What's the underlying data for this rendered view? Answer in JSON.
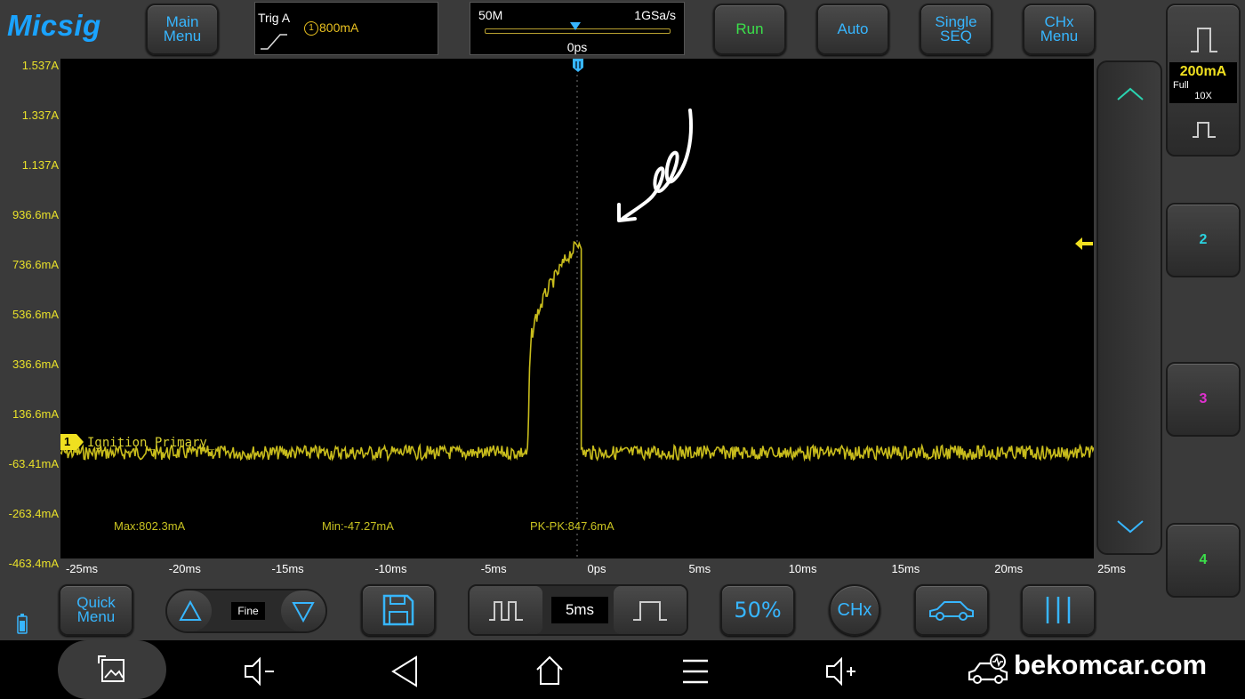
{
  "app": {
    "logo": "Micsig"
  },
  "top_bar": {
    "main_menu": "Main Menu",
    "trigger": {
      "title": "Trig A",
      "channel": "1",
      "level": "800mA"
    },
    "timebase": {
      "memory": "50M",
      "sample_rate": "1GSa/s",
      "position": "0ps"
    },
    "run": "Run",
    "auto": "Auto",
    "single": "Single SEQ",
    "chx_menu": "CHx Menu"
  },
  "right_panel": {
    "ch1_scale": "200mA",
    "ch1_bw": "Full",
    "ch1_probe": "10X",
    "ch2": "2",
    "ch3": "3",
    "ch4": "4"
  },
  "y_axis": [
    "1.537A",
    "1.337A",
    "1.137A",
    "936.6mA",
    "736.6mA",
    "536.6mA",
    "336.6mA",
    "136.6mA",
    "-63.41mA",
    "-263.4mA",
    "-463.4mA"
  ],
  "x_axis": [
    "-25ms",
    "-20ms",
    "-15ms",
    "-10ms",
    "-5ms",
    "0ps",
    "5ms",
    "10ms",
    "15ms",
    "20ms",
    "25ms"
  ],
  "channel": {
    "marker": "1",
    "label": "Ignition_Primary_"
  },
  "measurements": {
    "max": "Max:802.3mA",
    "min": "Min:-47.27mA",
    "pkpk": "PK-PK:847.6mA"
  },
  "bottom_bar": {
    "quick_menu": "Quick Menu",
    "fine": "Fine",
    "timebase_value": "5ms",
    "fifty": "50%",
    "chx": "CHx"
  },
  "watermark": "bekomcar.com",
  "chart_data": {
    "type": "line",
    "title": "",
    "xlabel": "",
    "ylabel": "",
    "x_unit": "ms",
    "y_unit": "mA",
    "xlim": [
      -25,
      25
    ],
    "ylim": [
      -463.4,
      1536.6
    ],
    "series": [
      {
        "name": "Ignition_Primary_",
        "color": "#c8bc1c",
        "x": [
          -25,
          -2.4,
          -2.35,
          -2.3,
          -2.2,
          -2.0,
          -1.5,
          -1.0,
          -0.5,
          0.0,
          0.1,
          0.2,
          0.2,
          25
        ],
        "y": [
          -40,
          -40,
          100,
          300,
          430,
          500,
          600,
          670,
          740,
          790,
          802,
          802,
          -40,
          -40
        ]
      }
    ],
    "cursor_x": 0,
    "trigger_level": 800,
    "grid": false
  },
  "colors": {
    "accent": "#37b6ff",
    "trace": "#c8bc1c",
    "run": "#3be04a",
    "ch2": "#2ad3e0",
    "ch3": "#e030d0",
    "ch4": "#3be04a",
    "scale_text": "#e8e02a"
  }
}
